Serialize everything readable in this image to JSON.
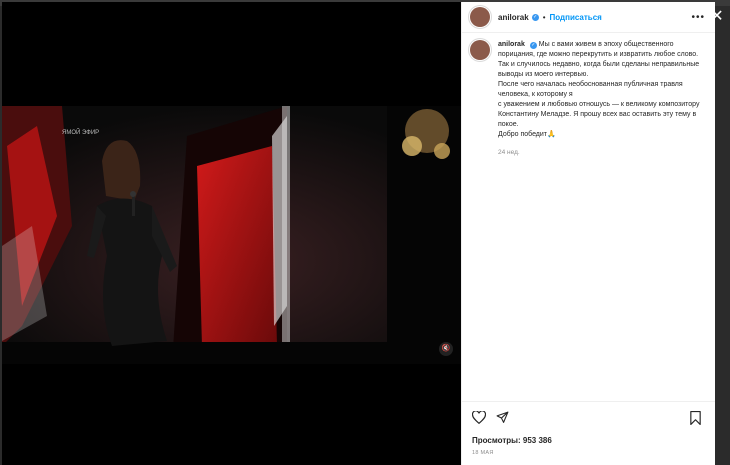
{
  "post": {
    "username": "anilorak",
    "follow_label": "Подписаться",
    "dot": "•",
    "more_label": "•••",
    "caption_lines": [
      "Мы с вами живем в эпоху общественного",
      "порицания, где можно перекрутить и извратить любое слово.",
      "Так и случилось недавно, когда были сделаны неправильные",
      "выводы из моего интервью.",
      "После чего началась необоснованная публичная травля",
      "человека, к которому я",
      "с уважением и любовью отношусь — к великому композитору",
      "Константину Меладзе. Я прошу всех вас оставить эту тему в",
      "покое.",
      "Добро победит🙏"
    ],
    "time_ago": "24 нед.",
    "views_text": "Просмотры: 953 386",
    "date": "18 МАЯ"
  },
  "video": {
    "overlay_text": "ЯМОЙ ЭФИР",
    "mute_label": "🔇"
  },
  "window": {
    "close_label": "✕"
  },
  "colors": {
    "accent": "#0095f6",
    "verified": "#3897f0"
  },
  "icons": [
    "heart-icon",
    "share-icon",
    "bookmark-icon",
    "close-icon",
    "mute-icon"
  ]
}
